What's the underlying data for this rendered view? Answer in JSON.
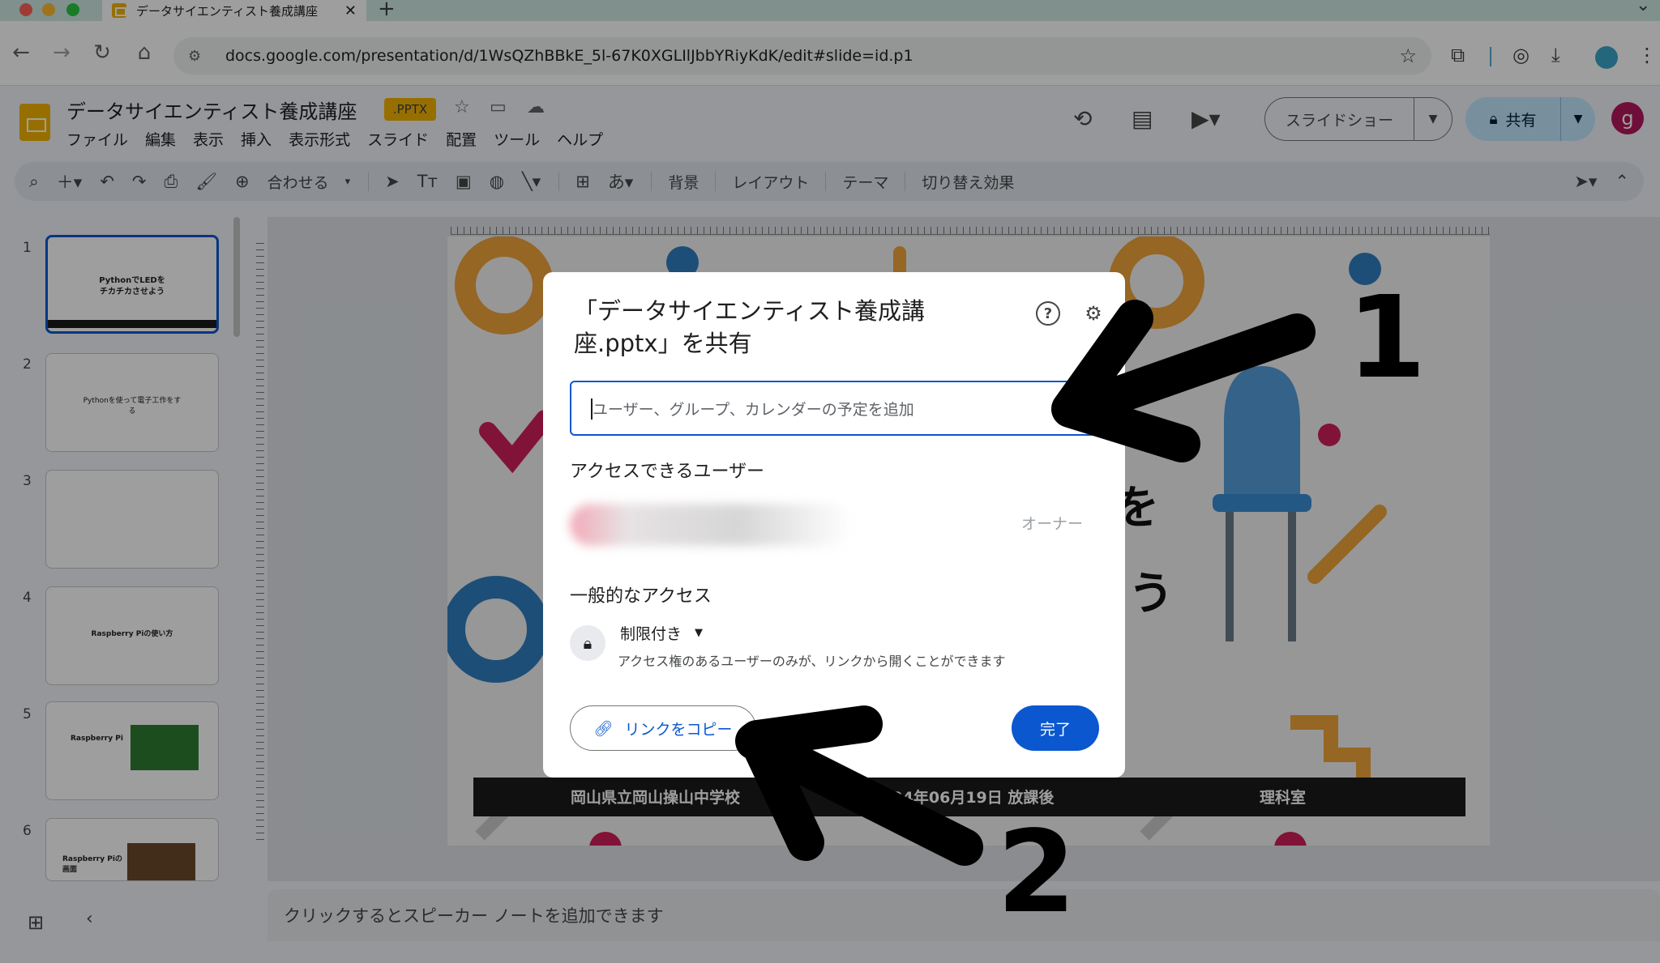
{
  "browser": {
    "tab_title": "データサイエンティスト養成講座",
    "tab_close": "✕",
    "new_tab": "+",
    "url": "docs.google.com/presentation/d/1WsQZhBBkE_5l-67K0XGLIlJbbYRiyKdK/edit#slide=id.p1"
  },
  "docs": {
    "title": "データサイエンティスト養成講座",
    "badge": ".PPTX",
    "menu": [
      "ファイル",
      "編集",
      "表示",
      "挿入",
      "表示形式",
      "スライド",
      "配置",
      "ツール",
      "ヘルプ"
    ],
    "slideshow_label": "スライドショー",
    "share_label": "共有",
    "avatar_letter": "g",
    "toolbar": {
      "fit_label": "合わせる",
      "background": "背景",
      "layout": "レイアウト",
      "theme": "テーマ",
      "transition": "切り替え効果"
    }
  },
  "filmstrip": {
    "numbers": [
      "1",
      "2",
      "3",
      "4",
      "5",
      "6"
    ],
    "thumb1_line1": "PythonでLEDを",
    "thumb1_line2": "チカチカさせよう",
    "thumb2_text": "Pythonを使って電子工作をする",
    "thumb4_text": "Raspberry Piの使い方",
    "thumb5_text": "Raspberry Pi",
    "thumb6_text": "Raspberry Piの画面"
  },
  "slide": {
    "footer_school": "岡山県立岡山操山中学校",
    "footer_date": "2024年06月19日 放課後",
    "footer_room": "理科室",
    "partial_text_1": "を",
    "partial_text_2": "う"
  },
  "notes": {
    "placeholder": "クリックするとスピーカー ノートを追加できます"
  },
  "share_dialog": {
    "title": "「データサイエンティスト養成講座.pptx」を共有",
    "input_placeholder": "ユーザー、グループ、カレンダーの予定を追加",
    "people_header": "アクセスできるユーザー",
    "owner_label": "オーナー",
    "general_access_header": "一般的なアクセス",
    "restriction": "制限付き",
    "restriction_desc": "アクセス権のあるユーザーのみが、リンクから開くことができます",
    "copy_link": "リンクをコピー",
    "done": "完了"
  },
  "annotations": {
    "label_1": "1",
    "label_2": "2"
  },
  "colors": {
    "accent_blue": "#0b57d0",
    "slides_yellow": "#f4b400",
    "share_bg": "#c2e7ff"
  }
}
